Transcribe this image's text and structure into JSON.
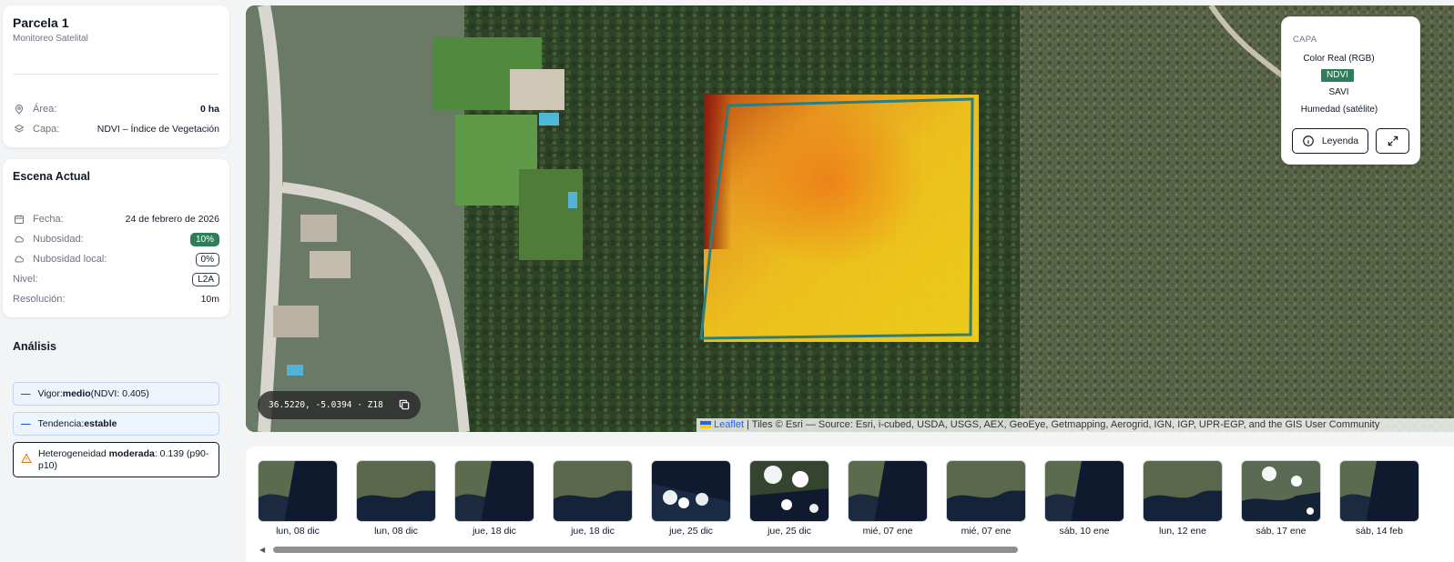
{
  "parcel": {
    "title": "Parcela 1",
    "subtitle": "Monitoreo Satelital",
    "area_label": "Área:",
    "area_value": "0 ha",
    "layer_label": "Capa:",
    "layer_value": "NDVI – Índice de Vegetación",
    "icons": {
      "area": "map-pin-icon",
      "layer": "layers-icon"
    }
  },
  "scene": {
    "title": "Escena Actual",
    "date_label": "Fecha:",
    "date_value": "24 de febrero de 2026",
    "cloud_label": "Nubosidad:",
    "cloud_value": "10%",
    "local_cloud_label": "Nubosidad local:",
    "local_cloud_value": "0%",
    "level_label": "Nivel:",
    "level_value": "L2A",
    "resolution_label": "Resolución:",
    "resolution_value": "10m",
    "icons": {
      "date": "calendar-icon",
      "cloud": "cloud-icon",
      "local_cloud": "cloud-icon"
    }
  },
  "analysis": {
    "title": "Análisis",
    "vigor_prefix": "Vigor: ",
    "vigor_value": "medio",
    "vigor_suffix": " (NDVI: 0.405)",
    "trend_prefix": "Tendencia: ",
    "trend_value": "estable",
    "hetero_prefix": "Heterogeneidad ",
    "hetero_value": "moderada",
    "hetero_suffix": ": 0.139 (p90-p10)",
    "icons": {
      "warning": "warning-triangle-icon"
    }
  },
  "map": {
    "layer_panel": {
      "heading": "CAPA",
      "options": [
        "Color Real (RGB)",
        "NDVI",
        "SAVI",
        "Humedad (satélite)"
      ],
      "active": "NDVI",
      "legend_button": "Leyenda",
      "legend_icon": "info-icon",
      "fullscreen_icon": "expand-icon"
    },
    "coordinates": "36.5220, -5.0394 · Z18",
    "copy_icon": "copy-icon",
    "attribution_link": "Leaflet",
    "attribution_text": " | Tiles © Esri — Source: Esri, i-cubed, USDA, USGS, AEX, GeoEye, Getmapping, Aerogrid, IGN, IGP, UPR-EGP, and the GIS User Community",
    "colors": {
      "parcel_outline": "#2f7d7a",
      "ndvi_low": "#8b1a10",
      "ndvi_mid": "#f08a1c",
      "ndvi_high": "#f5d21a"
    }
  },
  "timeline": {
    "scenes": [
      {
        "date": "lun, 08 dic",
        "type": "half-dark"
      },
      {
        "date": "lun, 08 dic",
        "type": "full-coast"
      },
      {
        "date": "jue, 18 dic",
        "type": "half-dark"
      },
      {
        "date": "jue, 18 dic",
        "type": "full-coast"
      },
      {
        "date": "jue, 25 dic",
        "type": "cloudy-split"
      },
      {
        "date": "jue, 25 dic",
        "type": "cloudy"
      },
      {
        "date": "mié, 07 ene",
        "type": "half-dark"
      },
      {
        "date": "mié, 07 ene",
        "type": "full-coast"
      },
      {
        "date": "sáb, 10 ene",
        "type": "half-dark"
      },
      {
        "date": "lun, 12 ene",
        "type": "full-coast"
      },
      {
        "date": "sáb, 17 ene",
        "type": "snowy"
      },
      {
        "date": "sáb, 14 feb",
        "type": "half-dark"
      }
    ]
  }
}
